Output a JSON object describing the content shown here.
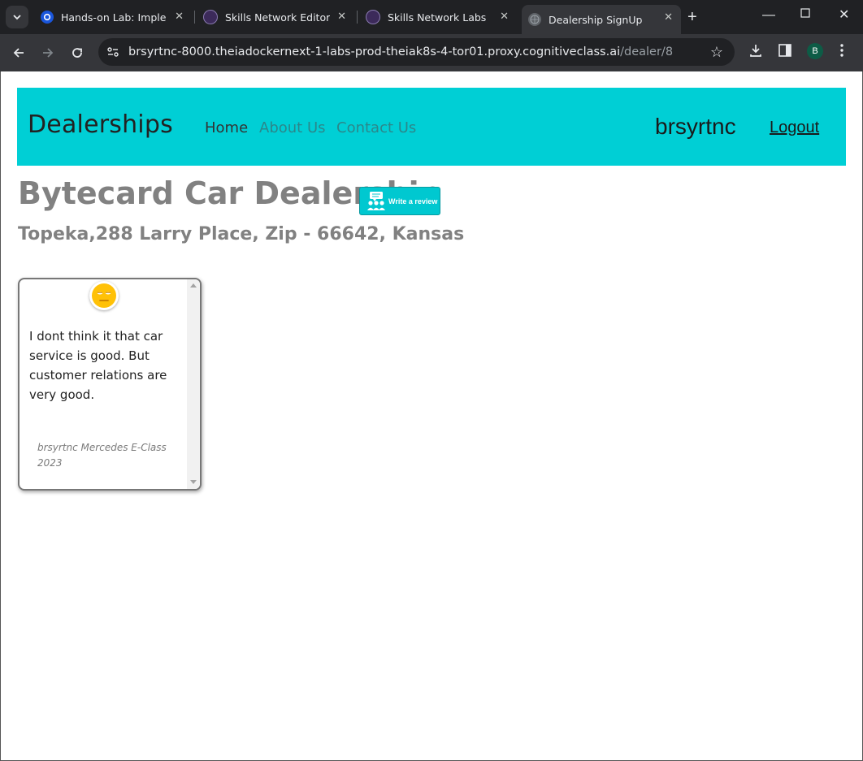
{
  "browser": {
    "tabs": [
      {
        "label": "Hands-on Lab: Implemen",
        "active": false
      },
      {
        "label": "Skills Network Editor",
        "active": false
      },
      {
        "label": "Skills Network Labs",
        "active": false
      },
      {
        "label": "Dealership SignUp",
        "active": true
      }
    ],
    "url_host": "brsyrtnc-8000.theiadockernext-1-labs-prod-theiak8s-4-tor01.proxy.cognitiveclass.ai",
    "url_path": "/dealer/8",
    "profile_initial": "B"
  },
  "navbar": {
    "brand": "Dealerships",
    "links": [
      "Home",
      "About Us",
      "Contact Us"
    ],
    "username": "brsyrtnc",
    "logout": "Logout",
    "background_color": "#00cfd5"
  },
  "dealer": {
    "title": "Bytecard Car Dealership",
    "address": "Topeka,288 Larry Place, Zip - 66642, Kansas",
    "review_button": "Write a review"
  },
  "reviews": [
    {
      "sentiment_icon": "neutral-face-icon",
      "text": "I dont think it that car service is good. But customer relations are very good.",
      "meta": "brsyrtnc Mercedes E-Class 2023"
    }
  ]
}
